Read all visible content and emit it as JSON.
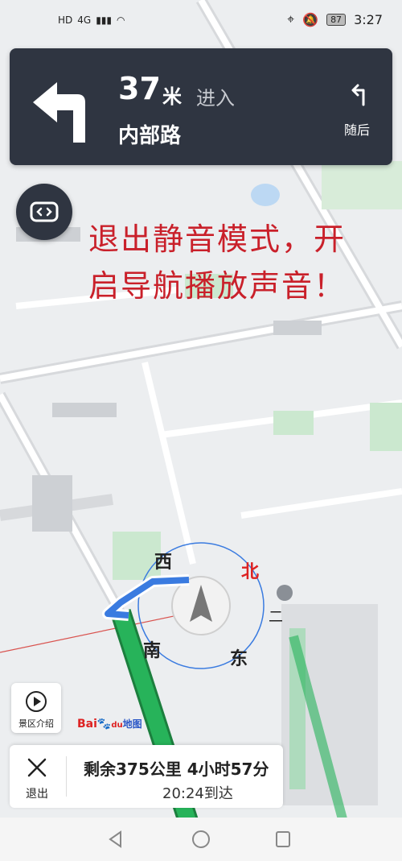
{
  "status_bar": {
    "left_items": [
      "HD",
      "4G",
      "📶",
      "WiFi"
    ],
    "battery": "87",
    "time": "3:27"
  },
  "nav_card": {
    "distance": "37",
    "distance_unit": "米",
    "action": "进入",
    "road": "内部路",
    "next_label": "随后"
  },
  "overlay_message": {
    "line1": "退出静音模式，开",
    "line2": "启导航播放声音！"
  },
  "compass": {
    "west": "西",
    "north": "北",
    "south": "南",
    "east": "东"
  },
  "scenic_button": {
    "label": "景区介绍"
  },
  "logo": {
    "bai": "Bai",
    "du": "du",
    "ditu": "地图"
  },
  "bottom_bar": {
    "exit_label": "退出",
    "remaining": "剩余375公里 4小时57分",
    "arrival": "20:24到达"
  },
  "map_label": "二",
  "colors": {
    "card_bg": "#2f3541",
    "route_green": "#27b35a",
    "message_red": "#c9202a",
    "accent_blue": "#3a7be0"
  }
}
